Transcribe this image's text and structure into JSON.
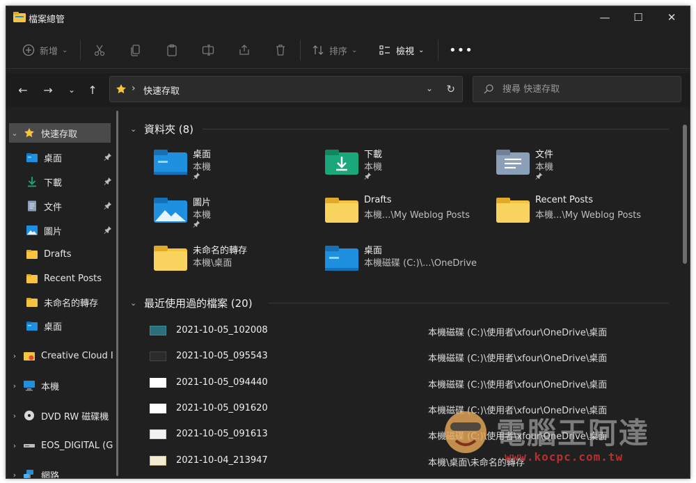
{
  "window": {
    "title": "檔案總管"
  },
  "toolbar": {
    "new_label": "新增",
    "sort_label": "排序",
    "view_label": "檢視"
  },
  "address": {
    "crumb": "快速存取"
  },
  "search": {
    "placeholder": "搜尋 快速存取"
  },
  "sidebar": {
    "items": [
      {
        "label": "快速存取",
        "icon": "star-icon",
        "pinned": false
      },
      {
        "label": "桌面",
        "icon": "desktop-folder-icon",
        "pinned": true
      },
      {
        "label": "下載",
        "icon": "download-icon",
        "pinned": true
      },
      {
        "label": "文件",
        "icon": "document-icon",
        "pinned": true
      },
      {
        "label": "圖片",
        "icon": "pictures-icon",
        "pinned": true
      },
      {
        "label": "Drafts",
        "icon": "folder-icon",
        "pinned": false
      },
      {
        "label": "Recent Posts",
        "icon": "folder-icon",
        "pinned": false
      },
      {
        "label": "未命名的轉存",
        "icon": "folder-icon",
        "pinned": false
      },
      {
        "label": "桌面",
        "icon": "desktop-folder-icon",
        "pinned": false
      },
      {
        "label": "Creative Cloud I",
        "icon": "creative-cloud-icon",
        "pinned": false
      },
      {
        "label": "本機",
        "icon": "computer-icon",
        "pinned": false
      },
      {
        "label": "DVD RW 磁碟機",
        "icon": "disc-icon",
        "pinned": false
      },
      {
        "label": "EOS_DIGITAL (G",
        "icon": "drive-icon",
        "pinned": false
      },
      {
        "label": "網路",
        "icon": "network-icon",
        "pinned": false
      }
    ]
  },
  "folders_section": {
    "title": "資料夾 (8)",
    "tiles": [
      {
        "name": "桌面",
        "path": "本機",
        "pinned": true
      },
      {
        "name": "下載",
        "path": "本機",
        "pinned": true
      },
      {
        "name": "文件",
        "path": "本機",
        "pinned": true
      },
      {
        "name": "圖片",
        "path": "本機",
        "pinned": true
      },
      {
        "name": "Drafts",
        "path": "本機...\\My Weblog Posts",
        "pinned": false
      },
      {
        "name": "Recent Posts",
        "path": "本機...\\My Weblog Posts",
        "pinned": false
      },
      {
        "name": "未命名的轉存",
        "path": "本機\\桌面",
        "pinned": false
      },
      {
        "name": "桌面",
        "path": "本機磁碟 (C:)\\...\\OneDrive",
        "pinned": false
      }
    ]
  },
  "recent_section": {
    "title": "最近使用過的檔案 (20)",
    "files": [
      {
        "name": "2021-10-05_102008",
        "path": "本機磁碟 (C:)\\使用者\\xfour\\OneDrive\\桌面"
      },
      {
        "name": "2021-10-05_095543",
        "path": "本機磁碟 (C:)\\使用者\\xfour\\OneDrive\\桌面"
      },
      {
        "name": "2021-10-05_094440",
        "path": "本機磁碟 (C:)\\使用者\\xfour\\OneDrive\\桌面"
      },
      {
        "name": "2021-10-05_091620",
        "path": "本機磁碟 (C:)\\使用者\\xfour\\OneDrive\\桌面"
      },
      {
        "name": "2021-10-05_091613",
        "path": "本機磁碟 (C:)\\使用者\\xfour\\OneDrive\\桌面"
      },
      {
        "name": "2021-10-04_213947",
        "path": "本機\\桌面\\未命名的轉存"
      }
    ]
  },
  "watermark": {
    "text": "電腦王阿達",
    "url": "www.kocpc.com.tw"
  },
  "colors": {
    "background": "#202020",
    "accent_folder": "#f5c542",
    "accent_blue": "#1f8fe0",
    "download_green": "#1aa87a"
  }
}
